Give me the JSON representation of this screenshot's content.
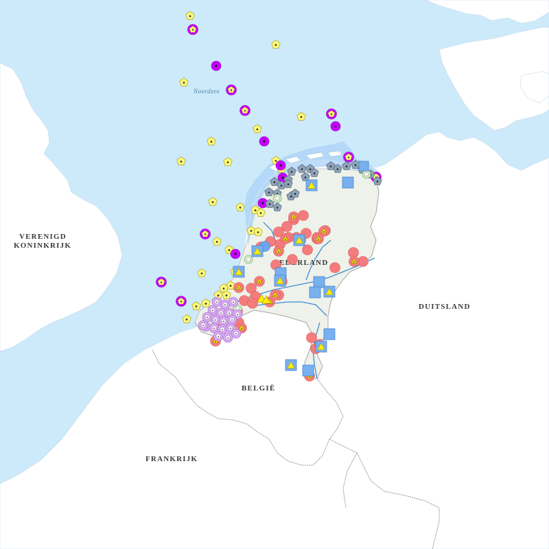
{
  "map": {
    "labels": {
      "sea": "Noordzee",
      "uk_line1": "VERENIGD",
      "uk_line2": "KONINKRIJK",
      "nl": "NEDERLAND",
      "de": "DUITSLAND",
      "be": "BELGIË",
      "fr": "FRANKRIJK"
    },
    "colors": {
      "water": "#cdeafb",
      "land": "#ffffff",
      "netherlands_land": "#eef2ea",
      "coastal_zone": "#a9d2f7",
      "river": "#3f8bd6",
      "border": "#9a9a9a",
      "yellow_pentagon": "#fffb7a",
      "magenta_circle": "#c800ff",
      "grey_pentagon": "#8fa3b8",
      "salmon_circle": "#f47c7c",
      "blue_square": "#78b0f0",
      "yellow_triangle": "#ffee00",
      "lilac_circle": "#d8a8f0",
      "teal_circle": "#6fb0a8"
    },
    "legend_symbols": [
      "yellow-pentagon-marker",
      "magenta-circle-marker",
      "grey-pentagon-marker",
      "salmon-circle-marker",
      "salmon-circle-triangle-marker",
      "blue-square-marker",
      "yellow-triangle-marker",
      "lilac-circle-marker",
      "blue-circle-marker"
    ]
  }
}
